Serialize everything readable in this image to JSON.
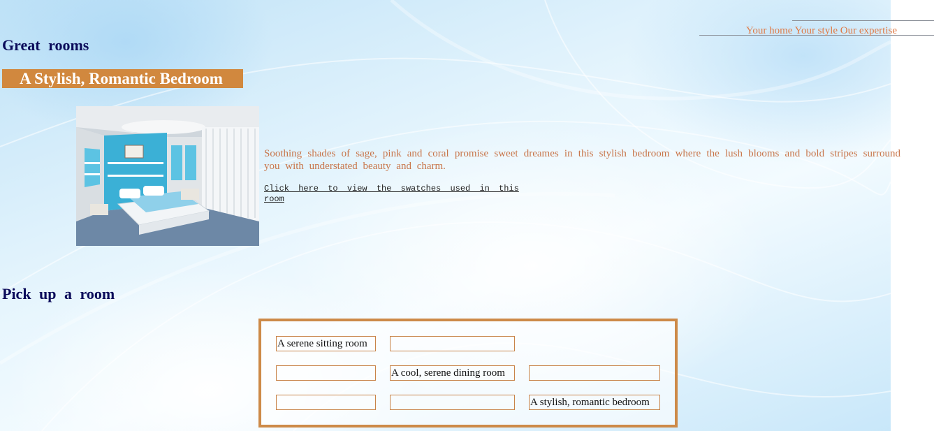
{
  "nav": {
    "links": [
      "Your home",
      "Your style",
      "Our expertise"
    ]
  },
  "great_rooms": {
    "heading": "Great  rooms",
    "room_title": "A Stylish, Romantic Bedroom",
    "photo_icon": "bedroom-photo",
    "description": "Soothing shades of sage, pink and coral promise sweet dreames in this stylish bedroom where the lush blooms and bold stripes surround you with understated beauty and charm.",
    "swatch_link": "Click here to view the swatches used in this room"
  },
  "pick_room": {
    "heading": "Pick  up  a  room",
    "rows": [
      [
        "A serene sitting room",
        "",
        ""
      ],
      [
        "",
        "A cool, serene dining room",
        ""
      ],
      [
        "",
        "",
        "A stylish, romantic bedroom"
      ]
    ]
  },
  "colors": {
    "accent": "#d1883e",
    "heading": "#0b0b5a",
    "body_text": "#c8754a",
    "nav_text": "#e07a45"
  }
}
